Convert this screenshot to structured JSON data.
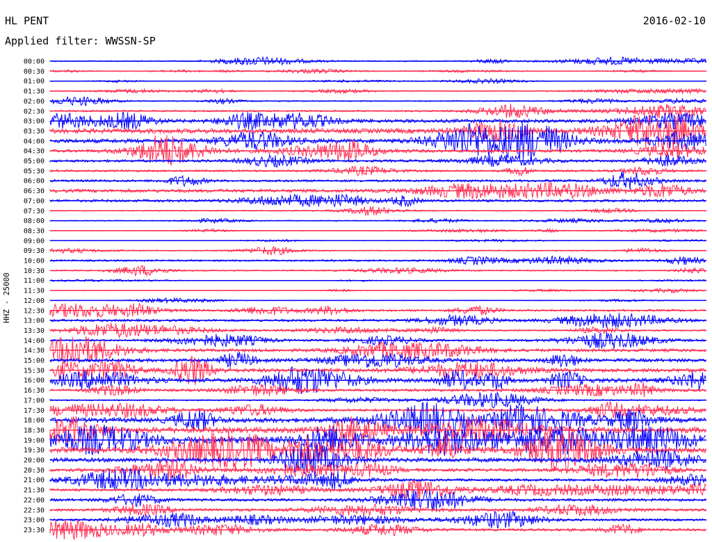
{
  "header": {
    "station": "HL PENT",
    "date": "2016-02-10",
    "filter": "Applied filter: WWSSN-SP"
  },
  "ylabel": "HHZ - 25000",
  "colors": {
    "odd_trace": "#0000ff",
    "even_trace": "#ff2a4f",
    "baseline": "#000000"
  },
  "chart_data": {
    "type": "line",
    "title": "HL PENT",
    "subtitle": "Applied filter: WWSSN-SP",
    "ylabel": "HHZ - 25000",
    "xlabel": "",
    "grid": false,
    "legend": "none",
    "row_labels": [
      "00:00",
      "00:30",
      "01:00",
      "01:30",
      "02:00",
      "02:30",
      "03:00",
      "03:30",
      "04:00",
      "04:30",
      "05:00",
      "05:30",
      "06:00",
      "06:30",
      "07:00",
      "07:30",
      "08:00",
      "08:30",
      "09:00",
      "09:30",
      "10:00",
      "10:30",
      "11:00",
      "11:30",
      "12:00",
      "12:30",
      "13:00",
      "13:30",
      "14:00",
      "14:30",
      "15:00",
      "15:30",
      "16:00",
      "16:30",
      "17:00",
      "17:30",
      "18:00",
      "18:30",
      "19:00",
      "19:30",
      "20:00",
      "20:30",
      "21:00",
      "21:30",
      "22:00",
      "22:30",
      "23:00",
      "23:30"
    ],
    "row_amplitude": [
      0.6,
      0.3,
      0.3,
      0.5,
      0.6,
      0.9,
      1.9,
      2.6,
      2.3,
      1.6,
      1.4,
      1.1,
      1.3,
      1.8,
      1.4,
      0.6,
      0.5,
      0.4,
      0.3,
      0.6,
      1.0,
      0.7,
      0.2,
      0.3,
      0.3,
      1.1,
      1.3,
      0.8,
      1.1,
      1.7,
      1.9,
      2.1,
      2.3,
      1.4,
      0.7,
      1.4,
      2.6,
      3.2,
      3.5,
      2.9,
      2.4,
      1.6,
      1.4,
      1.3,
      1.5,
      1.4,
      1.2,
      1.4
    ]
  }
}
